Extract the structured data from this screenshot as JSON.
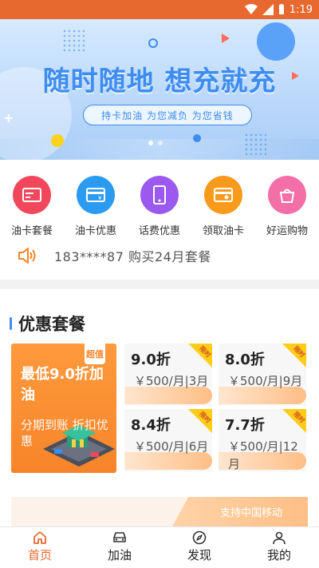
{
  "status_bar": {
    "time": "1:19"
  },
  "banner": {
    "title": "随时随地 想充就充",
    "subtitle": "持卡加油 为您减负 为您省钱",
    "slides": 2,
    "active_slide": 1
  },
  "menu": {
    "items": [
      {
        "label": "油卡套餐",
        "icon": "card-package-icon",
        "color": "#f0485a"
      },
      {
        "label": "油卡优惠",
        "icon": "card-discount-icon",
        "color": "#2b9bf0"
      },
      {
        "label": "话费优惠",
        "icon": "phone-icon",
        "color": "#9b59f0"
      },
      {
        "label": "领取油卡",
        "icon": "card-receive-icon",
        "color": "#f89a1c"
      },
      {
        "label": "好运购物",
        "icon": "shopping-bag-icon",
        "color": "#f46fa8"
      }
    ]
  },
  "notice": {
    "icon": "speaker-icon",
    "text": "183****87 购买24月套餐"
  },
  "packages": {
    "title": "优惠套餐",
    "featured": {
      "badge": "超值",
      "title": "最低9.0折加油",
      "subtitle": "分期到账 折扣优惠"
    },
    "cards": [
      {
        "discount": "9.0折",
        "price": "￥500/月|3月",
        "tag": "限时"
      },
      {
        "discount": "8.0折",
        "price": "￥500/月|9月",
        "tag": "限时"
      },
      {
        "discount": "8.4折",
        "price": "￥500/月|6月",
        "tag": "限时"
      },
      {
        "discount": "7.7折",
        "price": "￥500/月|12月",
        "tag": "限时"
      }
    ]
  },
  "promo": {
    "label": "支持中国移动"
  },
  "tabbar": {
    "active": "首页",
    "items": [
      {
        "label": "首页",
        "icon": "home-icon"
      },
      {
        "label": "加油",
        "icon": "car-icon"
      },
      {
        "label": "发现",
        "icon": "compass-icon"
      },
      {
        "label": "我的",
        "icon": "user-icon"
      }
    ]
  },
  "colors": {
    "accent": "#e8692f",
    "banner_blue": "#3d8cf0",
    "package_orange": "#f7842a"
  }
}
